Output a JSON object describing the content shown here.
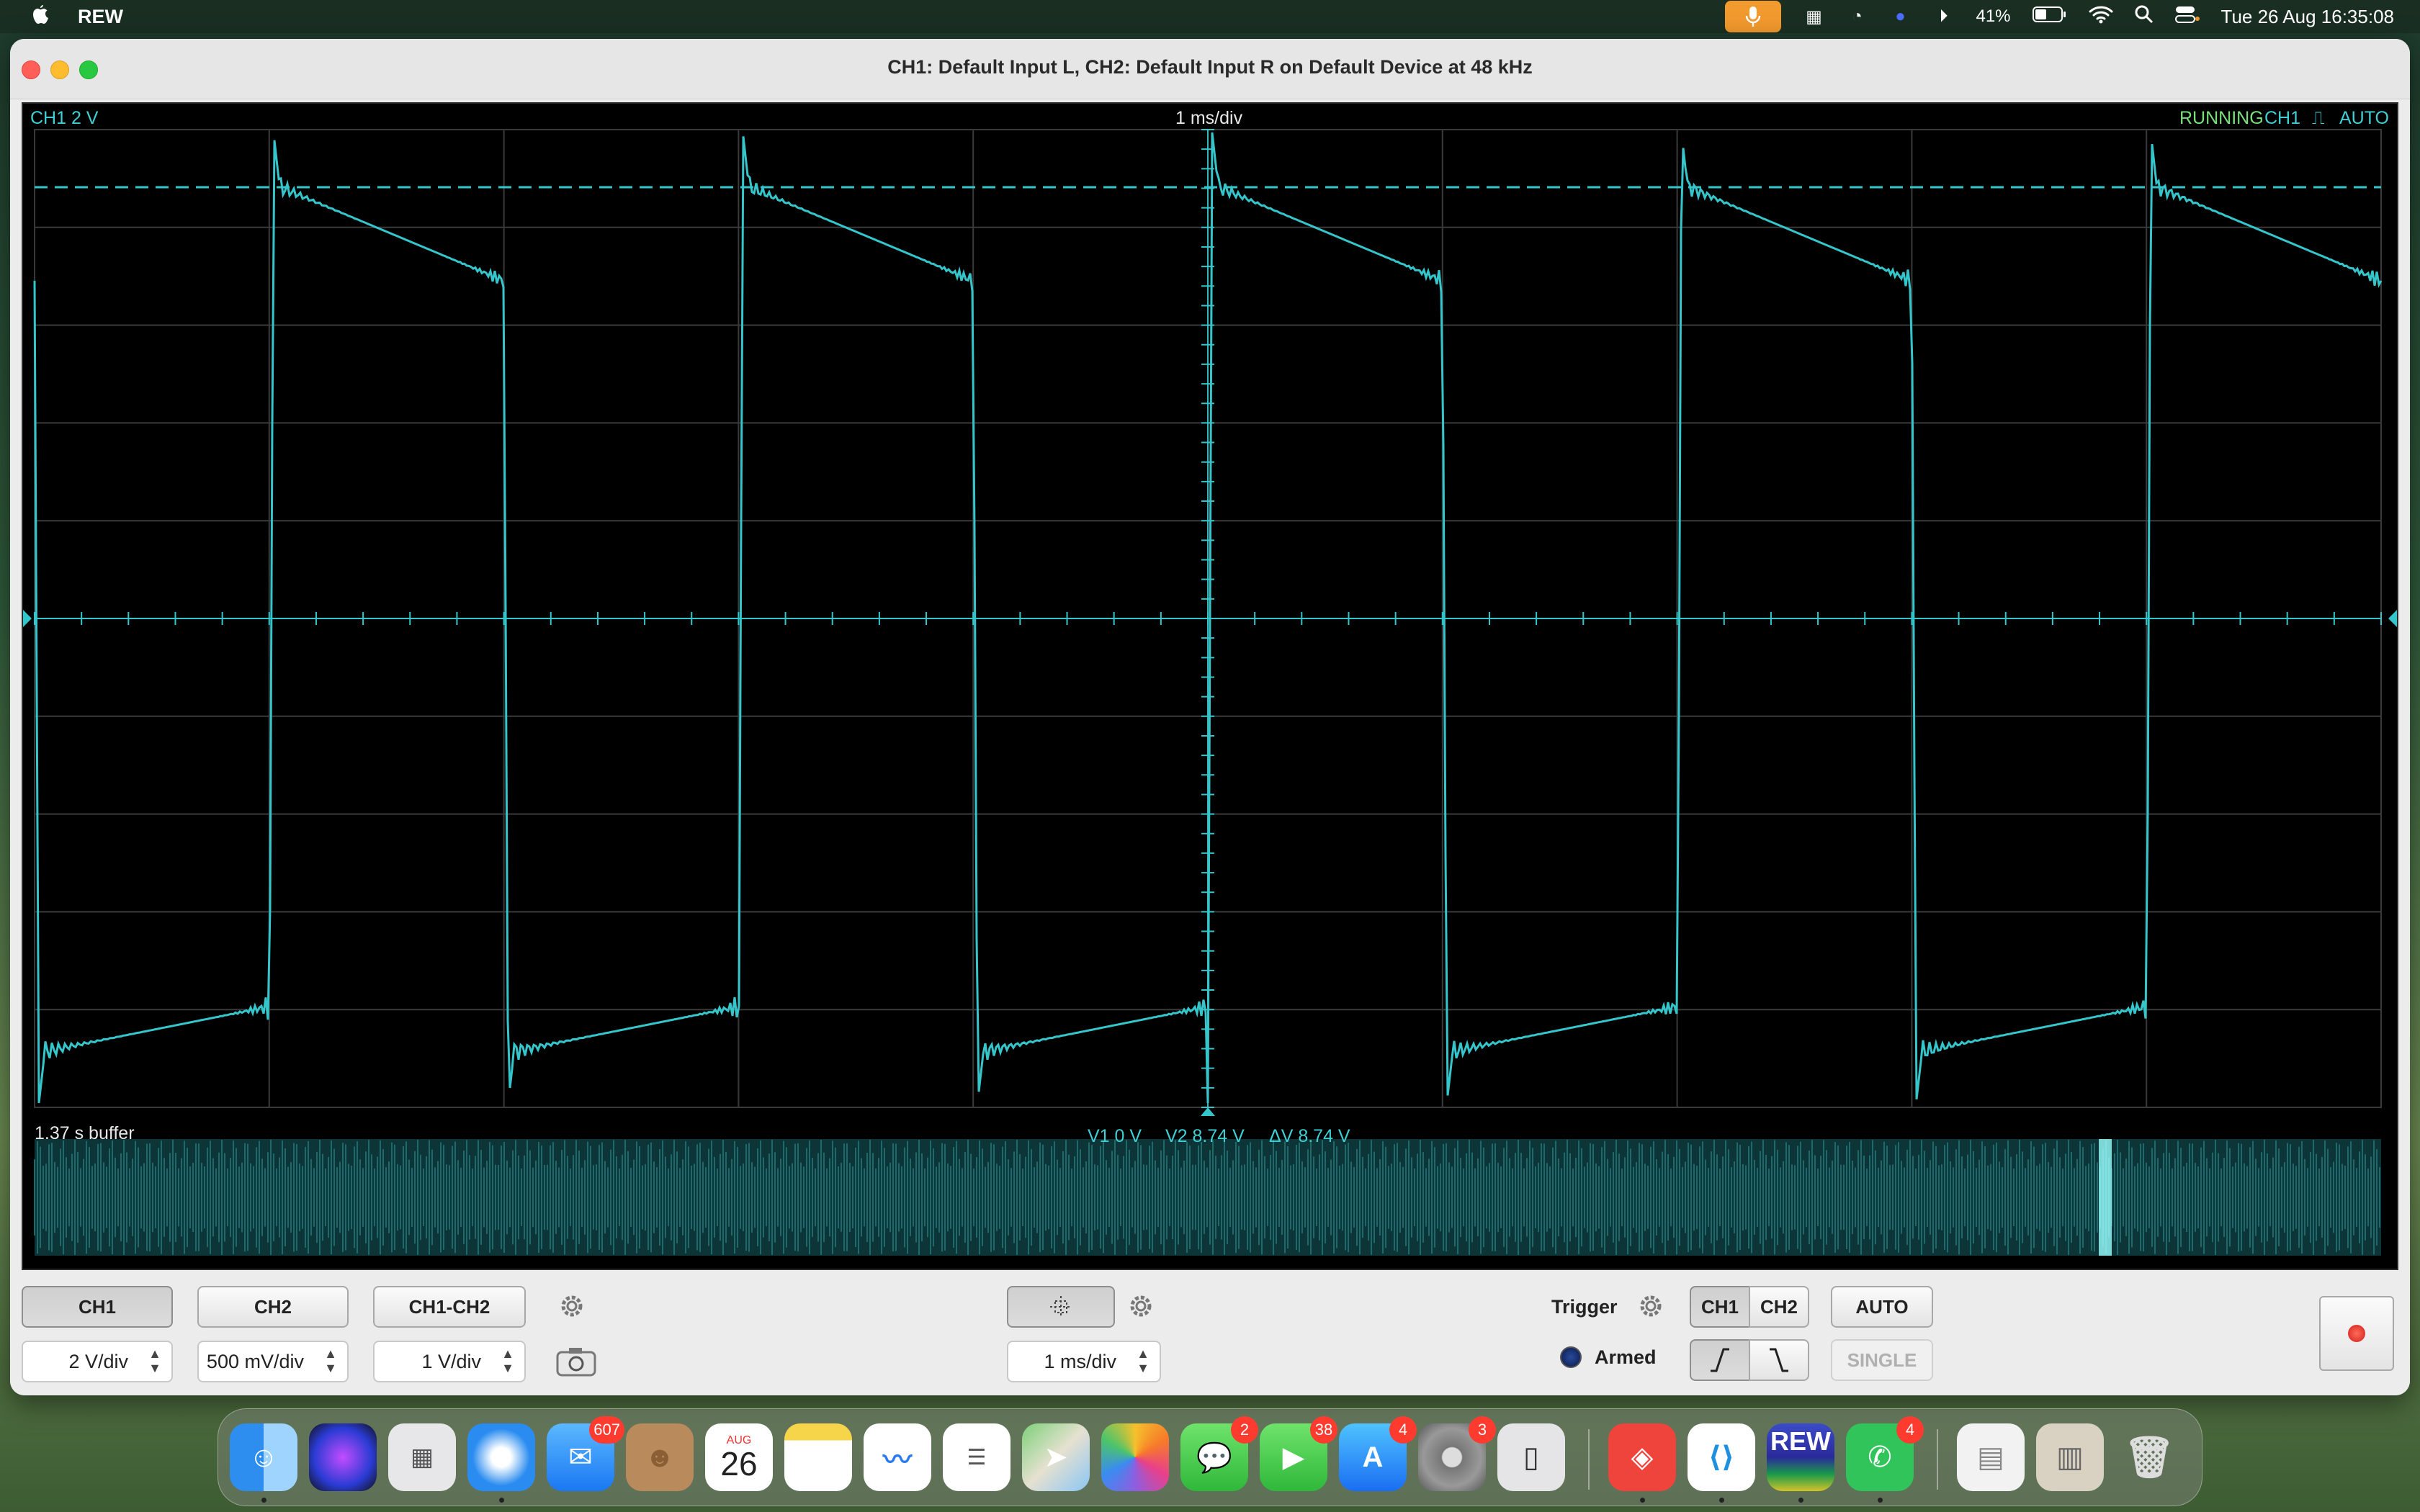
{
  "menubar": {
    "apple": "",
    "app_name": "REW",
    "battery": "41%",
    "datetime": "Tue 26 Aug  16:35:08"
  },
  "window": {
    "title": "CH1: Default Input L, CH2: Default Input R on Default Device at 48 kHz"
  },
  "scope": {
    "ch_scale": "CH1 2 V",
    "timebase": "1 ms/div",
    "status": "RUNNING",
    "trig_ch": "CH1",
    "trig_mode": "AUTO",
    "buffer": "1.37 s buffer",
    "v1": "V1 0 V",
    "v2": "V2 8.74 V",
    "dv": "ΔV 8.74 V",
    "trace_color": "#35c6cc"
  },
  "controls": {
    "ch1": "CH1",
    "ch2": "CH2",
    "ch1_ch2": "CH1-CH2",
    "ch1_scale": "2 V/div",
    "ch2_scale": "500 mV/div",
    "diff_scale": "1 V/div",
    "timebase": "1 ms/div",
    "trigger_label": "Trigger",
    "trig_ch1": "CH1",
    "trig_ch2": "CH2",
    "auto": "AUTO",
    "single": "SINGLE",
    "armed": "Armed"
  },
  "dock": {
    "mail_badge": "607",
    "calendar_month": "AUG",
    "calendar_day": "26",
    "messages_badge": "2",
    "facetime_badge": "38",
    "appstore_badge": "4",
    "settings_badge": "3",
    "whatsapp_badge": "4",
    "rew_label": "REW"
  }
}
